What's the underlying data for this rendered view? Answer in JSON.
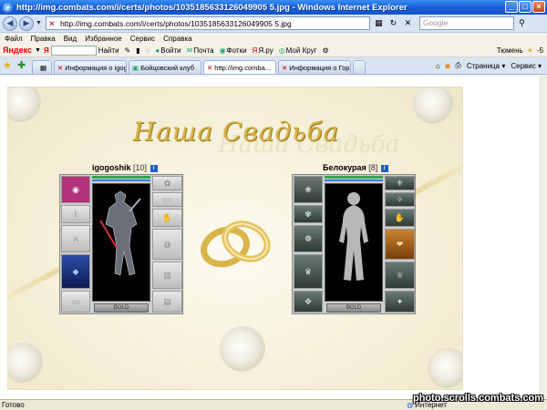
{
  "window": {
    "title": "http://img.combats.com/i/certs/photos/1035185633126049905 5.jpg - Windows Internet Explorer",
    "min": "_",
    "max": "□",
    "close": "×"
  },
  "address": {
    "url": "http://img.combats.com/i/certs/photos/1035185633126049905 5.jpg",
    "search_placeholder": "Google"
  },
  "menu": [
    "Файл",
    "Правка",
    "Вид",
    "Избранное",
    "Сервис",
    "Справка"
  ],
  "yandex": {
    "logo_main": "Яндекс",
    "logo_letter": "Я",
    "find": "Найти",
    "buttons": [
      "Войти",
      "Почта",
      "Фотки",
      "Я.ру",
      "Мой Круг"
    ],
    "city": "Тюмень",
    "temp": "-5"
  },
  "tabs": [
    {
      "label": "Информация о igogo..."
    },
    {
      "label": "Бойцовский клуб"
    },
    {
      "label": "http://img.comba..."
    },
    {
      "label": "Информация о Горг..."
    }
  ],
  "tabtools": {
    "page": "Страница",
    "service": "Сервис"
  },
  "card": {
    "heading": "Наша Свадьба"
  },
  "groom": {
    "name": "igogoshik",
    "level": "[10]",
    "plate": "BOLD"
  },
  "bride": {
    "name": "Белокурая",
    "level": "[8]",
    "plate": "BOLD"
  },
  "status": {
    "left": "Готово",
    "zone": "Интернет"
  },
  "watermark": "photo.scrolls.combats.com",
  "colors": {
    "accent": "#1a5fd6",
    "hp": "#2ea84a",
    "gold": "#d7b14a"
  }
}
